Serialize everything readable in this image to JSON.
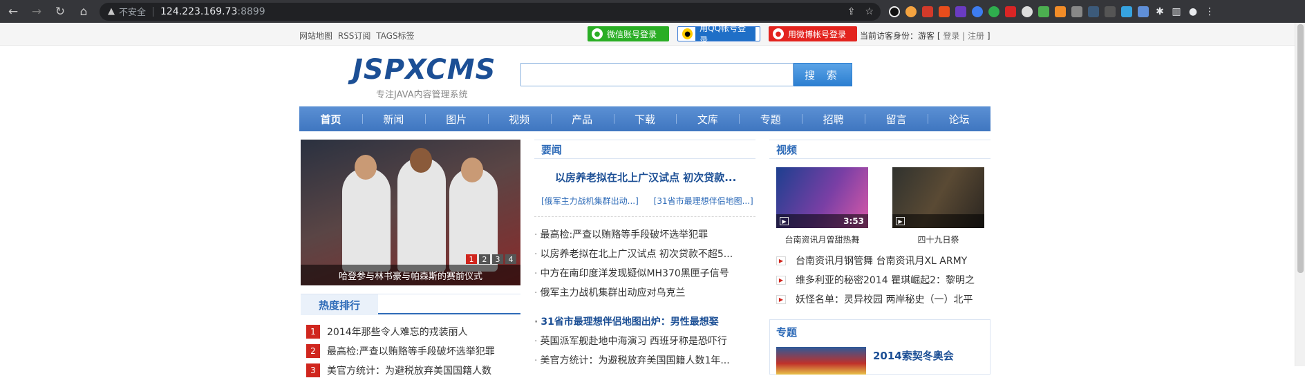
{
  "browser": {
    "insecure_label": "不安全",
    "url_host": "124.223.169.73",
    "url_port": ":8899"
  },
  "topbar": {
    "links": [
      "网站地图",
      "RSS订阅",
      "TAGS标签"
    ],
    "wechat_login": "微信账号登录",
    "qq_login": "用QQ帐号登录",
    "weibo_login": "用微博帐号登录",
    "visitor_label": "当前访客身份：游客 [",
    "login_link": "登录",
    "divider": "|",
    "register_link": "注册",
    "visitor_end": "]"
  },
  "header": {
    "logo": "JSPXCMS",
    "slogan": "专注JAVA内容管理系统",
    "search_button": "搜 索",
    "search_value": ""
  },
  "nav": {
    "items": [
      "首页",
      "新闻",
      "图片",
      "视频",
      "产品",
      "下载",
      "文库",
      "专题",
      "招聘",
      "留言",
      "论坛"
    ]
  },
  "slider": {
    "caption": "哈登参与林书豪与帕森斯的赛前仪式",
    "pages": [
      "1",
      "2",
      "3",
      "4"
    ]
  },
  "hot": {
    "title": "热度排行",
    "items": [
      {
        "rank": "1",
        "text": "2014年那些令人难忘的戎装丽人"
      },
      {
        "rank": "2",
        "text": "最高检:严查以贿赂等手段破坏选举犯罪"
      },
      {
        "rank": "3",
        "text": "美官方统计：为避税放弃美国国籍人数"
      }
    ]
  },
  "news": {
    "title": "要闻",
    "headline": "以房养老拟在北上广汉试点 初次贷款...",
    "sub_links": [
      "[俄军主力战机集群出动...]",
      "[31省市最理想伴侣地图...]"
    ],
    "items": [
      {
        "text": "最高检:严查以贿赂等手段破坏选举犯罪",
        "bold": false
      },
      {
        "text": "以房养老拟在北上广汉试点 初次贷款不超5...",
        "bold": false
      },
      {
        "text": "中方在南印度洋发现疑似MH370黑匣子信号",
        "bold": false
      },
      {
        "text": "俄军主力战机集群出动应对乌克兰",
        "bold": false
      },
      {
        "text": "31省市最理想伴侣地图出炉：男性最想娶",
        "bold": true
      },
      {
        "text": "英国派军舰赴地中海演习 西班牙称是恐吓行",
        "bold": false
      },
      {
        "text": "美官方统计：为避税放弃美国国籍人数1年...",
        "bold": false
      }
    ]
  },
  "video": {
    "title": "视频",
    "thumbs": [
      {
        "caption": "台南资讯月曾甜热舞",
        "duration": "3:53"
      },
      {
        "caption": "四十九日祭",
        "duration": ""
      }
    ],
    "items": [
      "台南资讯月钢管舞  台南资讯月XL ARMY",
      "维多利亚的秘密2014  瞿琪崛起2：黎明之",
      "妖怪名单：灵异校园  两岸秘史（一）北平"
    ]
  },
  "topic": {
    "title": "专题",
    "feature": "2014索契冬奥会"
  },
  "colors": {
    "nav_blue": "#3f76c0",
    "link_blue": "#1c4f95",
    "rank_red": "#d0261e",
    "wechat_green": "#2aae25",
    "weibo_red": "#e3231e"
  }
}
